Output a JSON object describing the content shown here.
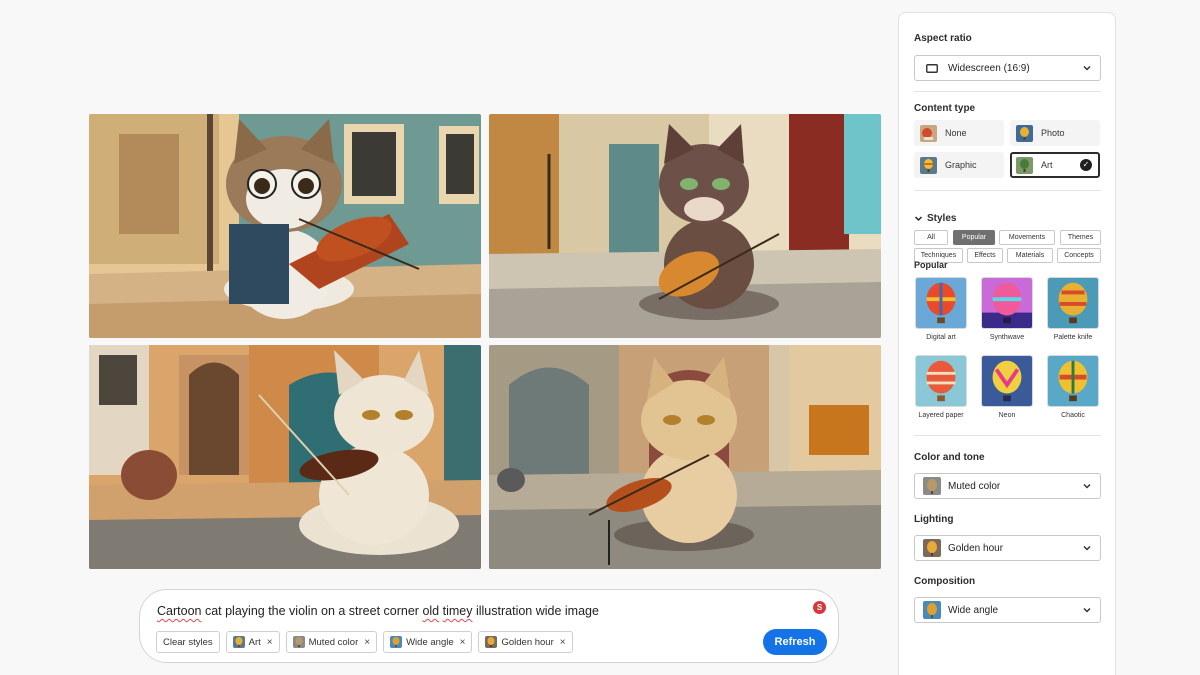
{
  "prompt": {
    "text_parts": [
      "Cartoon",
      " cat playing the violin on a street corner ",
      "old",
      " ",
      "timey",
      " illustration wide image"
    ],
    "clear_styles_label": "Clear styles",
    "chips": [
      {
        "label": "Art",
        "remove": "×"
      },
      {
        "label": "Muted color",
        "remove": "×"
      },
      {
        "label": "Wide angle",
        "remove": "×"
      },
      {
        "label": "Golden hour",
        "remove": "×"
      }
    ],
    "refresh_label": "Refresh",
    "badge": "S"
  },
  "panel": {
    "aspect_ratio": {
      "title": "Aspect ratio",
      "value": "Widescreen (16:9)"
    },
    "content_type": {
      "title": "Content type",
      "options": [
        {
          "label": "None",
          "selected": false
        },
        {
          "label": "Photo",
          "selected": false
        },
        {
          "label": "Graphic",
          "selected": false
        },
        {
          "label": "Art",
          "selected": true
        }
      ]
    },
    "styles": {
      "title": "Styles",
      "tabs": [
        "All",
        "Popular",
        "Movements",
        "Themes",
        "Techniques",
        "Effects",
        "Materials",
        "Concepts"
      ],
      "active_tab": "Popular",
      "group_title": "Popular",
      "items": [
        "Digital art",
        "Synthwave",
        "Palette knife",
        "Layered paper",
        "Neon",
        "Chaotic"
      ]
    },
    "color_tone": {
      "title": "Color and tone",
      "value": "Muted color"
    },
    "lighting": {
      "title": "Lighting",
      "value": "Golden hour"
    },
    "composition": {
      "title": "Composition",
      "value": "Wide angle"
    }
  },
  "colors": {
    "accent": "#1473e6",
    "selected_tab": "#707070"
  }
}
